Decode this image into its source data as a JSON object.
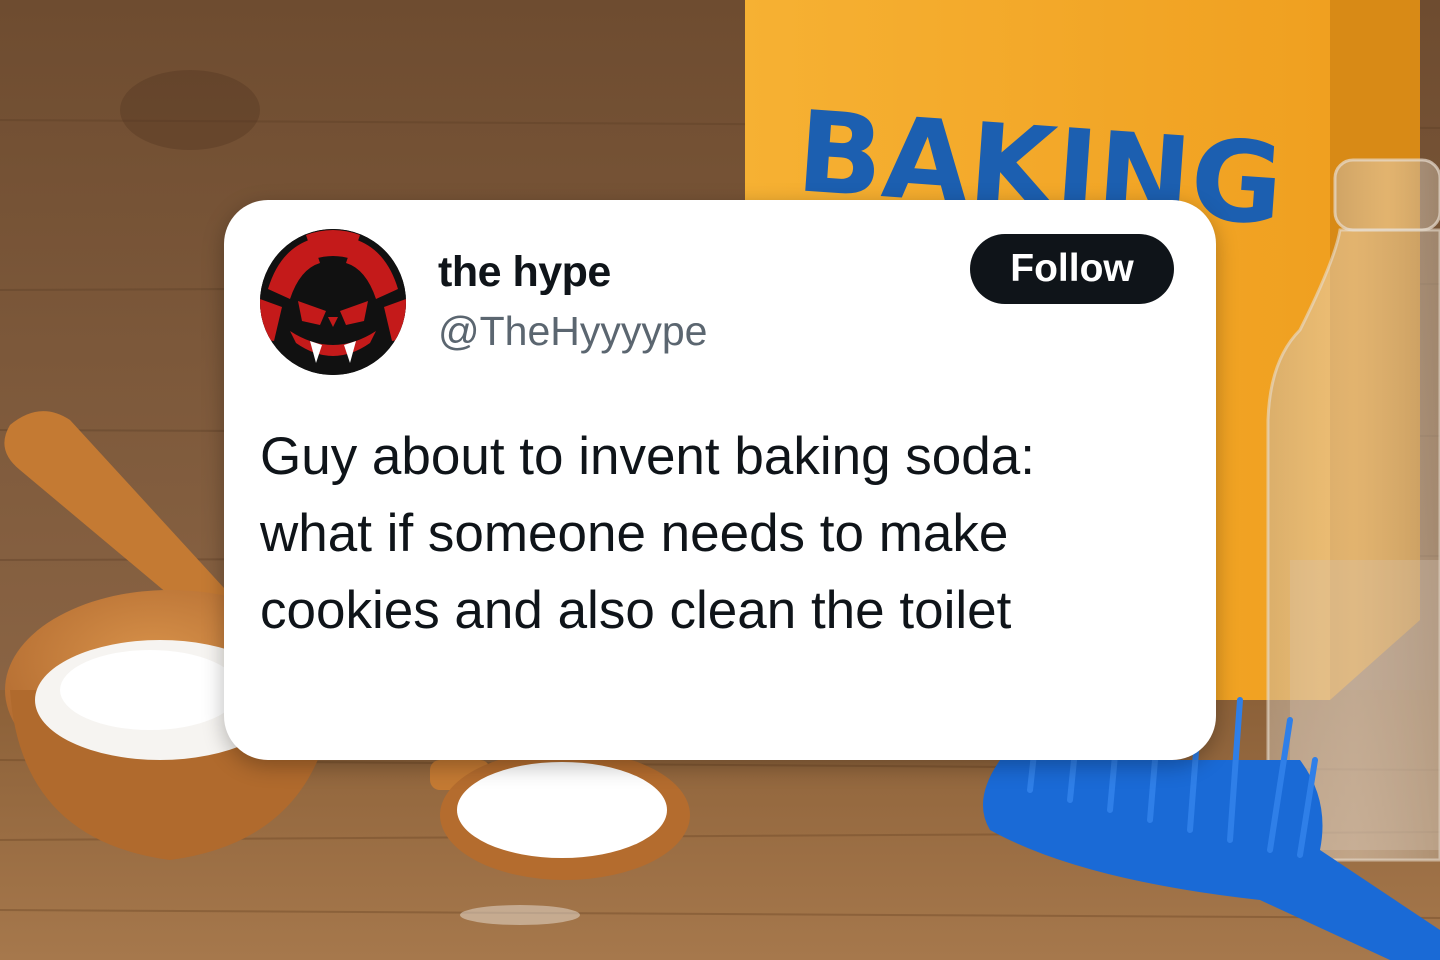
{
  "background": {
    "box_label": "BAKING",
    "colors": {
      "wood": "#7a5536",
      "box": "#f4a928",
      "box_text": "#1c5fb0",
      "brush": "#1a6ad6",
      "spoon": "#c47a33"
    }
  },
  "post": {
    "author": {
      "display_name": "the hype",
      "handle": "@TheHyyyype",
      "avatar_icon": "devil-face-icon"
    },
    "follow_label": "Follow",
    "text_lines": [
      "Guy about to invent baking soda:",
      "what if someone needs to make",
      "cookies and also clean the toilet"
    ]
  }
}
